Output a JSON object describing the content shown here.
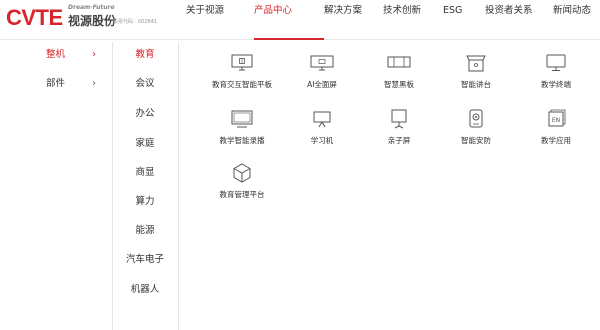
{
  "brand": {
    "logo_text": "CVTE",
    "tagline": "Dream·Future",
    "name_cn": "视源股份",
    "stock_code": "股票代码：002841"
  },
  "nav": {
    "items": [
      {
        "label": "关于视源",
        "active": false
      },
      {
        "label": "产品中心",
        "active": true
      },
      {
        "label": "解决方案",
        "active": false
      },
      {
        "label": "技术创新",
        "active": false
      },
      {
        "label": "ESG",
        "active": false
      },
      {
        "label": "投资者关系",
        "active": false
      },
      {
        "label": "新闻动态",
        "active": false
      }
    ]
  },
  "accent_color": "#d6262b",
  "category_level1": [
    {
      "label": "整机",
      "chevron": "chevron-right-icon",
      "active": true
    },
    {
      "label": "部件",
      "chevron": "chevron-right-icon",
      "active": false
    }
  ],
  "category_level2": [
    {
      "label": "教育",
      "active": true
    },
    {
      "label": "会议",
      "active": false
    },
    {
      "label": "办公",
      "active": false
    },
    {
      "label": "家庭",
      "active": false
    },
    {
      "label": "商显",
      "active": false
    },
    {
      "label": "算力",
      "active": false
    },
    {
      "label": "能源",
      "active": false
    },
    {
      "label": "汽车电子",
      "active": false
    },
    {
      "label": "机器人",
      "active": false
    }
  ],
  "products": [
    {
      "label": "教育交互智能平板",
      "icon": "interactive-panel-icon"
    },
    {
      "label": "AI全面屏",
      "icon": "ai-fullscreen-icon"
    },
    {
      "label": "智慧黑板",
      "icon": "smart-blackboard-icon"
    },
    {
      "label": "智能讲台",
      "icon": "smart-podium-icon"
    },
    {
      "label": "教学终端",
      "icon": "monitor-icon"
    },
    {
      "label": "教学智能录播",
      "icon": "recording-display-icon"
    },
    {
      "label": "学习机",
      "icon": "learning-tablet-icon"
    },
    {
      "label": "亲子屏",
      "icon": "family-screen-icon"
    },
    {
      "label": "智能安防",
      "icon": "security-camera-icon"
    },
    {
      "label": "教学应用",
      "icon": "teaching-app-icon"
    },
    {
      "label": "教育管理平台",
      "icon": "cube-icon"
    }
  ]
}
